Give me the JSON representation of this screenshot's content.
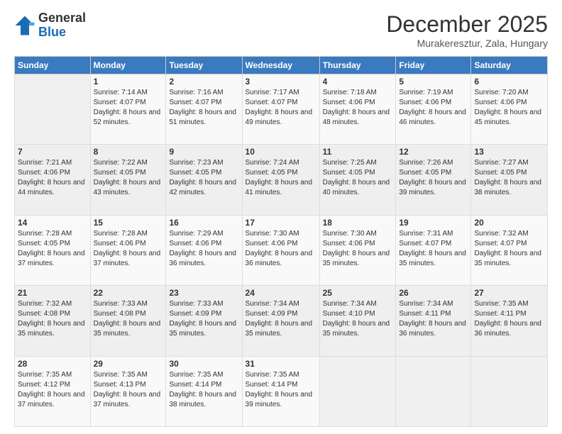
{
  "logo": {
    "general": "General",
    "blue": "Blue"
  },
  "header": {
    "month": "December 2025",
    "location": "Murakeresztur, Zala, Hungary"
  },
  "days_of_week": [
    "Sunday",
    "Monday",
    "Tuesday",
    "Wednesday",
    "Thursday",
    "Friday",
    "Saturday"
  ],
  "weeks": [
    [
      {
        "day": "",
        "sunrise": "",
        "sunset": "",
        "daylight": ""
      },
      {
        "day": "1",
        "sunrise": "Sunrise: 7:14 AM",
        "sunset": "Sunset: 4:07 PM",
        "daylight": "Daylight: 8 hours and 52 minutes."
      },
      {
        "day": "2",
        "sunrise": "Sunrise: 7:16 AM",
        "sunset": "Sunset: 4:07 PM",
        "daylight": "Daylight: 8 hours and 51 minutes."
      },
      {
        "day": "3",
        "sunrise": "Sunrise: 7:17 AM",
        "sunset": "Sunset: 4:07 PM",
        "daylight": "Daylight: 8 hours and 49 minutes."
      },
      {
        "day": "4",
        "sunrise": "Sunrise: 7:18 AM",
        "sunset": "Sunset: 4:06 PM",
        "daylight": "Daylight: 8 hours and 48 minutes."
      },
      {
        "day": "5",
        "sunrise": "Sunrise: 7:19 AM",
        "sunset": "Sunset: 4:06 PM",
        "daylight": "Daylight: 8 hours and 46 minutes."
      },
      {
        "day": "6",
        "sunrise": "Sunrise: 7:20 AM",
        "sunset": "Sunset: 4:06 PM",
        "daylight": "Daylight: 8 hours and 45 minutes."
      }
    ],
    [
      {
        "day": "7",
        "sunrise": "Sunrise: 7:21 AM",
        "sunset": "Sunset: 4:06 PM",
        "daylight": "Daylight: 8 hours and 44 minutes."
      },
      {
        "day": "8",
        "sunrise": "Sunrise: 7:22 AM",
        "sunset": "Sunset: 4:05 PM",
        "daylight": "Daylight: 8 hours and 43 minutes."
      },
      {
        "day": "9",
        "sunrise": "Sunrise: 7:23 AM",
        "sunset": "Sunset: 4:05 PM",
        "daylight": "Daylight: 8 hours and 42 minutes."
      },
      {
        "day": "10",
        "sunrise": "Sunrise: 7:24 AM",
        "sunset": "Sunset: 4:05 PM",
        "daylight": "Daylight: 8 hours and 41 minutes."
      },
      {
        "day": "11",
        "sunrise": "Sunrise: 7:25 AM",
        "sunset": "Sunset: 4:05 PM",
        "daylight": "Daylight: 8 hours and 40 minutes."
      },
      {
        "day": "12",
        "sunrise": "Sunrise: 7:26 AM",
        "sunset": "Sunset: 4:05 PM",
        "daylight": "Daylight: 8 hours and 39 minutes."
      },
      {
        "day": "13",
        "sunrise": "Sunrise: 7:27 AM",
        "sunset": "Sunset: 4:05 PM",
        "daylight": "Daylight: 8 hours and 38 minutes."
      }
    ],
    [
      {
        "day": "14",
        "sunrise": "Sunrise: 7:28 AM",
        "sunset": "Sunset: 4:05 PM",
        "daylight": "Daylight: 8 hours and 37 minutes."
      },
      {
        "day": "15",
        "sunrise": "Sunrise: 7:28 AM",
        "sunset": "Sunset: 4:06 PM",
        "daylight": "Daylight: 8 hours and 37 minutes."
      },
      {
        "day": "16",
        "sunrise": "Sunrise: 7:29 AM",
        "sunset": "Sunset: 4:06 PM",
        "daylight": "Daylight: 8 hours and 36 minutes."
      },
      {
        "day": "17",
        "sunrise": "Sunrise: 7:30 AM",
        "sunset": "Sunset: 4:06 PM",
        "daylight": "Daylight: 8 hours and 36 minutes."
      },
      {
        "day": "18",
        "sunrise": "Sunrise: 7:30 AM",
        "sunset": "Sunset: 4:06 PM",
        "daylight": "Daylight: 8 hours and 35 minutes."
      },
      {
        "day": "19",
        "sunrise": "Sunrise: 7:31 AM",
        "sunset": "Sunset: 4:07 PM",
        "daylight": "Daylight: 8 hours and 35 minutes."
      },
      {
        "day": "20",
        "sunrise": "Sunrise: 7:32 AM",
        "sunset": "Sunset: 4:07 PM",
        "daylight": "Daylight: 8 hours and 35 minutes."
      }
    ],
    [
      {
        "day": "21",
        "sunrise": "Sunrise: 7:32 AM",
        "sunset": "Sunset: 4:08 PM",
        "daylight": "Daylight: 8 hours and 35 minutes."
      },
      {
        "day": "22",
        "sunrise": "Sunrise: 7:33 AM",
        "sunset": "Sunset: 4:08 PM",
        "daylight": "Daylight: 8 hours and 35 minutes."
      },
      {
        "day": "23",
        "sunrise": "Sunrise: 7:33 AM",
        "sunset": "Sunset: 4:09 PM",
        "daylight": "Daylight: 8 hours and 35 minutes."
      },
      {
        "day": "24",
        "sunrise": "Sunrise: 7:34 AM",
        "sunset": "Sunset: 4:09 PM",
        "daylight": "Daylight: 8 hours and 35 minutes."
      },
      {
        "day": "25",
        "sunrise": "Sunrise: 7:34 AM",
        "sunset": "Sunset: 4:10 PM",
        "daylight": "Daylight: 8 hours and 35 minutes."
      },
      {
        "day": "26",
        "sunrise": "Sunrise: 7:34 AM",
        "sunset": "Sunset: 4:11 PM",
        "daylight": "Daylight: 8 hours and 36 minutes."
      },
      {
        "day": "27",
        "sunrise": "Sunrise: 7:35 AM",
        "sunset": "Sunset: 4:11 PM",
        "daylight": "Daylight: 8 hours and 36 minutes."
      }
    ],
    [
      {
        "day": "28",
        "sunrise": "Sunrise: 7:35 AM",
        "sunset": "Sunset: 4:12 PM",
        "daylight": "Daylight: 8 hours and 37 minutes."
      },
      {
        "day": "29",
        "sunrise": "Sunrise: 7:35 AM",
        "sunset": "Sunset: 4:13 PM",
        "daylight": "Daylight: 8 hours and 37 minutes."
      },
      {
        "day": "30",
        "sunrise": "Sunrise: 7:35 AM",
        "sunset": "Sunset: 4:14 PM",
        "daylight": "Daylight: 8 hours and 38 minutes."
      },
      {
        "day": "31",
        "sunrise": "Sunrise: 7:35 AM",
        "sunset": "Sunset: 4:14 PM",
        "daylight": "Daylight: 8 hours and 39 minutes."
      },
      {
        "day": "",
        "sunrise": "",
        "sunset": "",
        "daylight": ""
      },
      {
        "day": "",
        "sunrise": "",
        "sunset": "",
        "daylight": ""
      },
      {
        "day": "",
        "sunrise": "",
        "sunset": "",
        "daylight": ""
      }
    ]
  ]
}
